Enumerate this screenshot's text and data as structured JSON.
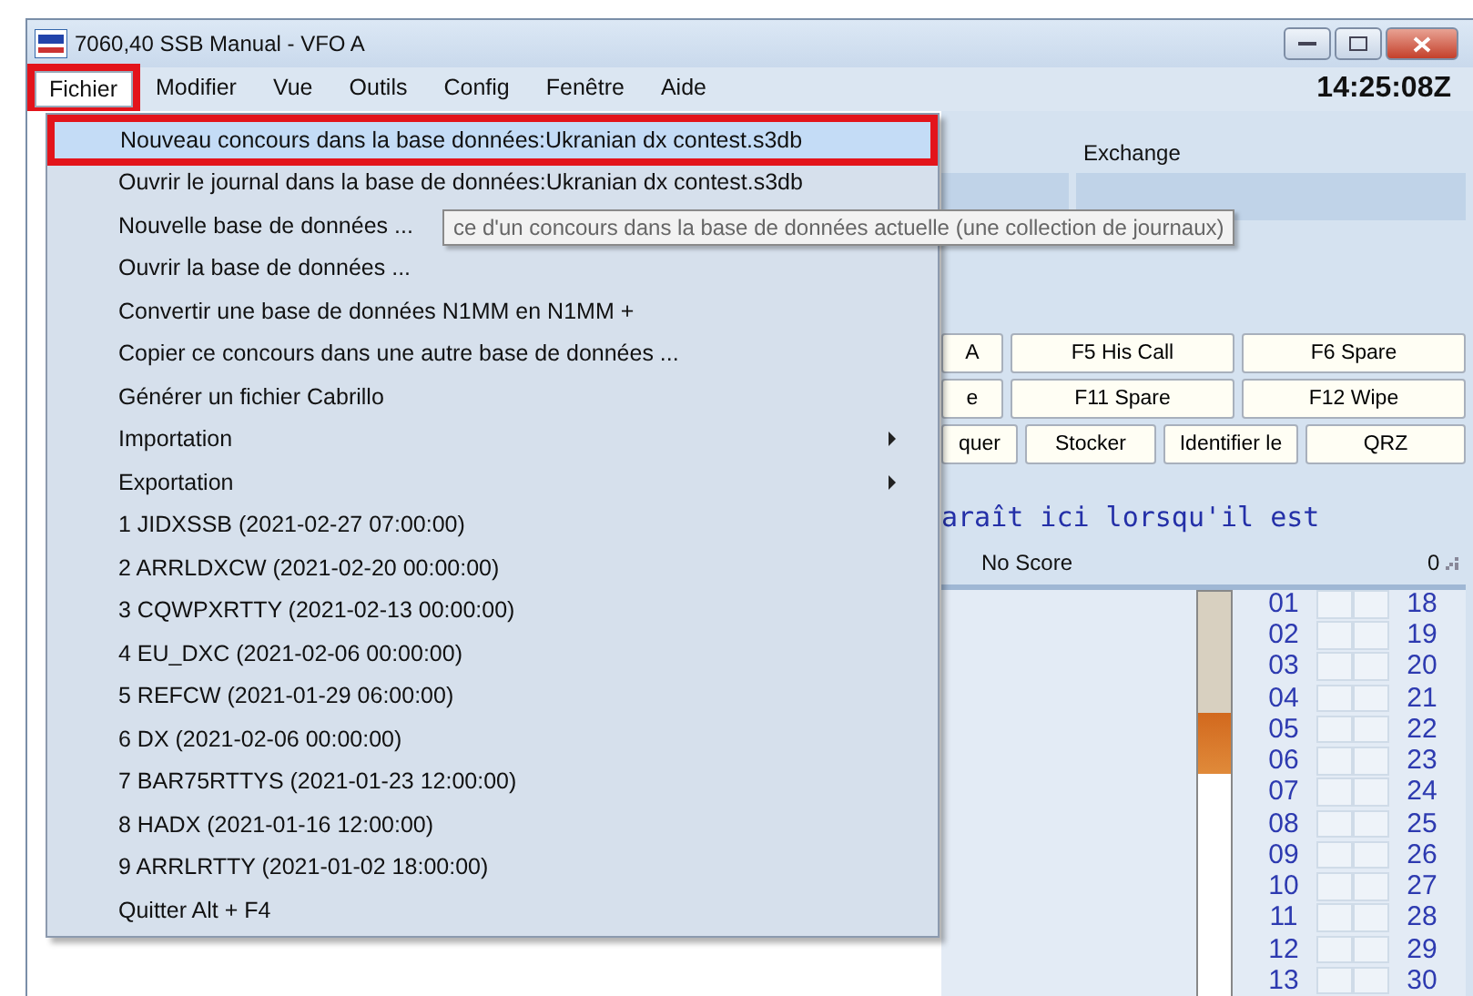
{
  "window": {
    "title": "7060,40 SSB Manual - VFO A",
    "clock": "14:25:08Z"
  },
  "menubar": [
    {
      "label": "Fichier",
      "selected": true,
      "annotated": true
    },
    {
      "label": "Modifier",
      "selected": false,
      "annotated": false
    },
    {
      "label": "Vue",
      "selected": false,
      "annotated": false
    },
    {
      "label": "Outils",
      "selected": false,
      "annotated": false
    },
    {
      "label": "Config",
      "selected": false,
      "annotated": false
    },
    {
      "label": "Fenêtre",
      "selected": false,
      "annotated": false
    },
    {
      "label": "Aide",
      "selected": false,
      "annotated": false
    }
  ],
  "menu": [
    {
      "label": "Nouveau concours dans la base données:Ukranian dx contest.s3db",
      "kind": "item",
      "selected": true,
      "annotated": true
    },
    {
      "label": "Ouvrir le journal dans la base de données:Ukranian dx contest.s3db",
      "kind": "item",
      "selected": false,
      "annotated": false
    },
    {
      "label": "Nouvelle base de données ...",
      "kind": "item",
      "selected": false,
      "annotated": false
    },
    {
      "label": "Ouvrir la base de données ...",
      "kind": "item",
      "selected": false,
      "annotated": false
    },
    {
      "label": "Convertir une base de données N1MM en N1MM +",
      "kind": "item",
      "selected": false,
      "annotated": false
    },
    {
      "label": "Copier ce concours dans une autre base de données ...",
      "kind": "item",
      "selected": false,
      "annotated": false
    },
    {
      "label": "Générer un fichier Cabrillo",
      "kind": "item",
      "selected": false,
      "annotated": false
    },
    {
      "label": "Importation",
      "kind": "submenu",
      "selected": false,
      "annotated": false
    },
    {
      "label": "Exportation",
      "kind": "submenu",
      "selected": false,
      "annotated": false
    },
    {
      "label": "1 JIDXSSB (2021-02-27 07:00:00)",
      "kind": "item",
      "selected": false,
      "annotated": false
    },
    {
      "label": "2 ARRLDXCW (2021-02-20 00:00:00)",
      "kind": "item",
      "selected": false,
      "annotated": false
    },
    {
      "label": "3 CQWPXRTTY (2021-02-13 00:00:00)",
      "kind": "item",
      "selected": false,
      "annotated": false
    },
    {
      "label": "4 EU_DXC (2021-02-06 00:00:00)",
      "kind": "item",
      "selected": false,
      "annotated": false
    },
    {
      "label": "5 REFCW (2021-01-29 06:00:00)",
      "kind": "item",
      "selected": false,
      "annotated": false
    },
    {
      "label": "6 DX (2021-02-06 00:00:00)",
      "kind": "item",
      "selected": false,
      "annotated": false
    },
    {
      "label": "7 BAR75RTTYS (2021-01-23 12:00:00)",
      "kind": "item",
      "selected": false,
      "annotated": false
    },
    {
      "label": "8 HADX (2021-01-16 12:00:00)",
      "kind": "item",
      "selected": false,
      "annotated": false
    },
    {
      "label": "9 ARRLRTTY (2021-01-02 18:00:00)",
      "kind": "item",
      "selected": false,
      "annotated": false
    },
    {
      "label": "Quitter Alt + F4",
      "kind": "item",
      "selected": false,
      "annotated": false
    }
  ],
  "tooltip": "ce d'un concours dans la base de données actuelle (une collection de journaux)",
  "entry": {
    "exchange_label": "Exchange"
  },
  "function_keys": [
    [
      "A",
      "F5 His Call",
      "F6 Spare"
    ],
    [
      "e",
      "F11 Spare",
      "F12 Wipe"
    ],
    [
      "quer",
      "Stocker",
      "Identifier le",
      "QRZ"
    ]
  ],
  "message": "araît ici lorsqu'il est",
  "score": {
    "label": "No Score",
    "value": "0"
  },
  "numbers": {
    "column_1": [
      "01",
      "02",
      "03",
      "04",
      "05",
      "06",
      "07",
      "08",
      "09",
      "10",
      "11",
      "12",
      "13"
    ],
    "column_2": [
      "18",
      "19",
      "20",
      "21",
      "22",
      "23",
      "24",
      "25",
      "26",
      "27",
      "28",
      "29",
      "30"
    ]
  }
}
